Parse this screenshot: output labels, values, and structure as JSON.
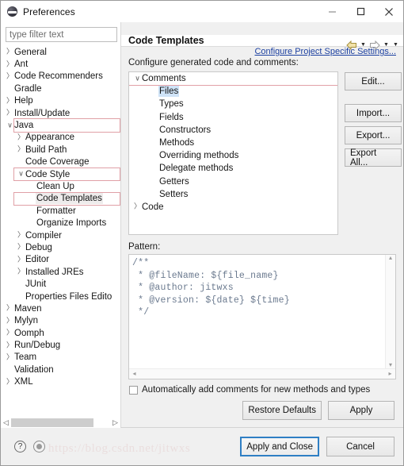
{
  "window": {
    "title": "Preferences",
    "icon": "eclipse-sphere-icon",
    "controls": {
      "minimize": "minimize-icon",
      "maximize": "maximize-icon",
      "close": "close-icon"
    }
  },
  "sidebar": {
    "filter": {
      "placeholder": "type filter text",
      "value": ""
    },
    "items": [
      {
        "label": "General",
        "indent": 0,
        "expander": "collapsed",
        "boxed": false,
        "selected": false
      },
      {
        "label": "Ant",
        "indent": 0,
        "expander": "collapsed",
        "boxed": false,
        "selected": false
      },
      {
        "label": "Code Recommenders",
        "indent": 0,
        "expander": "collapsed",
        "boxed": false,
        "selected": false
      },
      {
        "label": "Gradle",
        "indent": 0,
        "expander": "none",
        "boxed": false,
        "selected": false
      },
      {
        "label": "Help",
        "indent": 0,
        "expander": "collapsed",
        "boxed": false,
        "selected": false
      },
      {
        "label": "Install/Update",
        "indent": 0,
        "expander": "collapsed",
        "boxed": false,
        "selected": false
      },
      {
        "label": "Java",
        "indent": 0,
        "expander": "expanded",
        "boxed": true,
        "selected": false
      },
      {
        "label": "Appearance",
        "indent": 1,
        "expander": "collapsed",
        "boxed": false,
        "selected": false
      },
      {
        "label": "Build Path",
        "indent": 1,
        "expander": "collapsed",
        "boxed": false,
        "selected": false
      },
      {
        "label": "Code Coverage",
        "indent": 1,
        "expander": "none",
        "boxed": false,
        "selected": false
      },
      {
        "label": "Code Style",
        "indent": 1,
        "expander": "expanded",
        "boxed": true,
        "selected": false
      },
      {
        "label": "Clean Up",
        "indent": 2,
        "expander": "none",
        "boxed": false,
        "selected": false
      },
      {
        "label": "Code Templates",
        "indent": 2,
        "expander": "none",
        "boxed": true,
        "selected": true
      },
      {
        "label": "Formatter",
        "indent": 2,
        "expander": "none",
        "boxed": false,
        "selected": false
      },
      {
        "label": "Organize Imports",
        "indent": 2,
        "expander": "none",
        "boxed": false,
        "selected": false
      },
      {
        "label": "Compiler",
        "indent": 1,
        "expander": "collapsed",
        "boxed": false,
        "selected": false
      },
      {
        "label": "Debug",
        "indent": 1,
        "expander": "collapsed",
        "boxed": false,
        "selected": false
      },
      {
        "label": "Editor",
        "indent": 1,
        "expander": "collapsed",
        "boxed": false,
        "selected": false
      },
      {
        "label": "Installed JREs",
        "indent": 1,
        "expander": "collapsed",
        "boxed": false,
        "selected": false
      },
      {
        "label": "JUnit",
        "indent": 1,
        "expander": "none",
        "boxed": false,
        "selected": false
      },
      {
        "label": "Properties Files Edito",
        "indent": 1,
        "expander": "none",
        "boxed": false,
        "selected": false
      },
      {
        "label": "Maven",
        "indent": 0,
        "expander": "collapsed",
        "boxed": false,
        "selected": false
      },
      {
        "label": "Mylyn",
        "indent": 0,
        "expander": "collapsed",
        "boxed": false,
        "selected": false
      },
      {
        "label": "Oomph",
        "indent": 0,
        "expander": "collapsed",
        "boxed": false,
        "selected": false
      },
      {
        "label": "Run/Debug",
        "indent": 0,
        "expander": "collapsed",
        "boxed": false,
        "selected": false
      },
      {
        "label": "Team",
        "indent": 0,
        "expander": "collapsed",
        "boxed": false,
        "selected": false
      },
      {
        "label": "Validation",
        "indent": 0,
        "expander": "none",
        "boxed": false,
        "selected": false
      },
      {
        "label": "XML",
        "indent": 0,
        "expander": "collapsed",
        "boxed": false,
        "selected": false
      }
    ],
    "hscroll": {
      "left_icon": "chevron-left-icon",
      "right_icon": "chevron-right-icon"
    }
  },
  "page": {
    "title": "Code Templates",
    "nav": {
      "back_icon": "back-arrow-icon",
      "back_menu_icon": "chevron-down-icon",
      "forward_icon": "forward-arrow-icon",
      "forward_menu_icon": "chevron-down-icon",
      "view_menu_icon": "chevron-down-icon"
    },
    "project_link": "Configure Project Specific Settings...",
    "caption": "Configure generated code and comments:",
    "tree": [
      {
        "label": "Comments",
        "indent": 0,
        "expander": "expanded",
        "boxed": true,
        "selected": false
      },
      {
        "label": "Files",
        "indent": 1,
        "expander": "none",
        "boxed": false,
        "selected": true
      },
      {
        "label": "Types",
        "indent": 1,
        "expander": "none",
        "boxed": false,
        "selected": false
      },
      {
        "label": "Fields",
        "indent": 1,
        "expander": "none",
        "boxed": false,
        "selected": false
      },
      {
        "label": "Constructors",
        "indent": 1,
        "expander": "none",
        "boxed": false,
        "selected": false
      },
      {
        "label": "Methods",
        "indent": 1,
        "expander": "none",
        "boxed": false,
        "selected": false
      },
      {
        "label": "Overriding methods",
        "indent": 1,
        "expander": "none",
        "boxed": false,
        "selected": false
      },
      {
        "label": "Delegate methods",
        "indent": 1,
        "expander": "none",
        "boxed": false,
        "selected": false
      },
      {
        "label": "Getters",
        "indent": 1,
        "expander": "none",
        "boxed": false,
        "selected": false
      },
      {
        "label": "Setters",
        "indent": 1,
        "expander": "none",
        "boxed": false,
        "selected": false
      },
      {
        "label": "Code",
        "indent": 0,
        "expander": "collapsed",
        "boxed": false,
        "selected": false
      }
    ],
    "side_buttons": {
      "edit": "Edit...",
      "import": "Import...",
      "export": "Export...",
      "export_all": "Export All..."
    },
    "pattern_caption": "Pattern:",
    "pattern_value": "/**\n * @fileName: ${file_name}\n * @author: jitwxs\n * @version: ${date} ${time}\n */",
    "pattern_scroll": {
      "up_icon": "chevron-up-icon",
      "down_icon": "chevron-down-icon",
      "left_icon": "chevron-left-icon",
      "right_icon": "chevron-right-icon"
    },
    "auto_comments": {
      "label": "Automatically add comments for new methods and types",
      "checked": false
    },
    "restore_defaults": "Restore Defaults",
    "apply": "Apply"
  },
  "footer": {
    "help_icon": "question-mark-icon",
    "record_icon": "record-dot-icon",
    "apply_and_close": "Apply and Close",
    "cancel": "Cancel",
    "watermark": "https://blog.csdn.net/jitwxs"
  },
  "colors": {
    "accent_link": "#1b3fa0",
    "highlight_box": "#e0a0a6",
    "selection": "#cfe3f7",
    "focus_border": "#2f7fc4",
    "pattern_text": "#6b7a8f"
  }
}
